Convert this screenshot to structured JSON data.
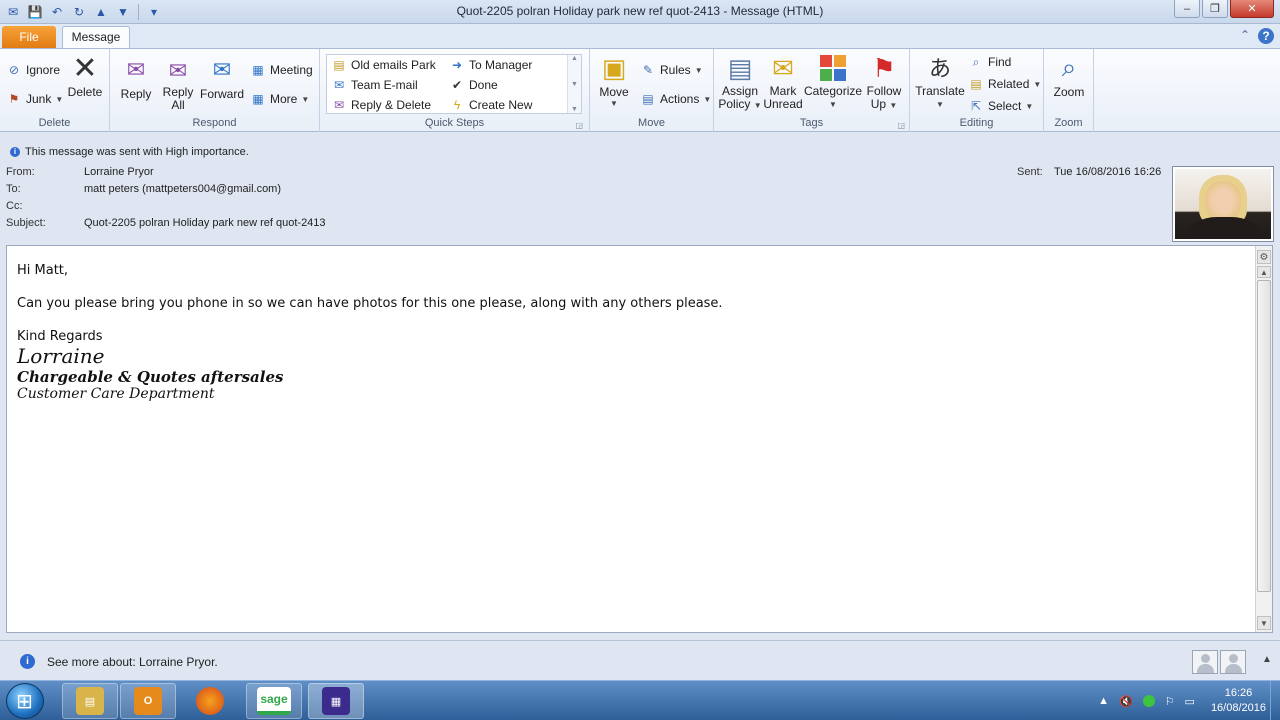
{
  "window": {
    "title": "Quot-2205 polran Holiday park new ref quot-2413  -  Message (HTML)",
    "minimize_glyph": "–",
    "restore_glyph": "❐",
    "close_glyph": "✕"
  },
  "tabs": {
    "file": "File",
    "message": "Message"
  },
  "ribbon": {
    "delete_group": {
      "label": "Delete",
      "ignore": "Ignore",
      "junk": "Junk",
      "delete": "Delete"
    },
    "respond_group": {
      "label": "Respond",
      "reply": "Reply",
      "reply_all_1": "Reply",
      "reply_all_2": "All",
      "forward": "Forward",
      "meeting": "Meeting",
      "more": "More"
    },
    "quicksteps_group": {
      "label": "Quick Steps",
      "items": [
        "Old emails Park",
        "To Manager",
        "Team E-mail",
        "Done",
        "Reply & Delete",
        "Create New"
      ]
    },
    "move_group": {
      "label": "Move",
      "move": "Move",
      "rules": "Rules",
      "actions": "Actions"
    },
    "tags_group": {
      "label": "Tags",
      "assign_1": "Assign",
      "assign_2": "Policy",
      "mark_1": "Mark",
      "mark_2": "Unread",
      "categorize": "Categorize",
      "follow_1": "Follow",
      "follow_2": "Up"
    },
    "editing_group": {
      "label": "Editing",
      "translate": "Translate",
      "find": "Find",
      "related": "Related",
      "select": "Select"
    },
    "zoom_group": {
      "label": "Zoom",
      "zoom": "Zoom"
    }
  },
  "header": {
    "importance": "This message was sent with High importance.",
    "from_label": "From:",
    "from": "Lorraine Pryor",
    "to_label": "To:",
    "to": "matt peters (mattpeters004@gmail.com)",
    "cc_label": "Cc:",
    "cc": "",
    "subject_label": "Subject:",
    "subject": "Quot-2205 polran Holiday park new ref quot-2413",
    "sent_label": "Sent:",
    "sent": "Tue 16/08/2016 16:26"
  },
  "body": {
    "greeting": "Hi Matt,",
    "line1": "Can you please bring you phone in so we can have photos for this one please, along with any others please.",
    "closing": "Kind Regards",
    "sig_name": "Lorraine",
    "sig_title": "Chargeable & Quotes aftersales",
    "sig_dept": "Customer Care Department"
  },
  "people_pane": {
    "text": "See more about: Lorraine Pryor."
  },
  "taskbar": {
    "items": [
      {
        "name": "explorer",
        "glyph": "▤",
        "color": "#d8b44a"
      },
      {
        "name": "outlook",
        "glyph": "O",
        "color": "#e68a1c"
      },
      {
        "name": "firefox",
        "glyph": "●",
        "color": "#e0641c"
      },
      {
        "name": "sage",
        "glyph": "sage",
        "color": "#2fa84a"
      },
      {
        "name": "app",
        "glyph": "▦",
        "color": "#3a2b8c"
      }
    ],
    "time": "16:26",
    "date": "16/08/2016"
  }
}
